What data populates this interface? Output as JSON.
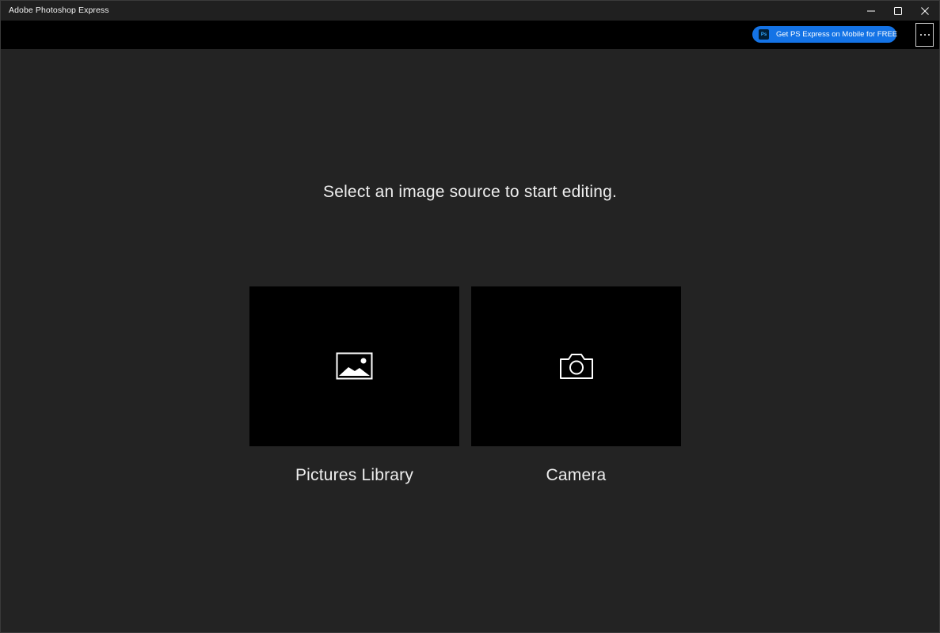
{
  "window": {
    "title": "Adobe Photoshop Express",
    "controls": {
      "minimize_icon": "minimize-icon",
      "maximize_icon": "maximize-icon",
      "close_icon": "close-icon"
    }
  },
  "toolbar": {
    "promo_label": "Get PS Express on Mobile for FREE",
    "promo_icon_text": "Ps",
    "more_icon": "more-options-icon"
  },
  "main": {
    "prompt": "Select an image source to start editing.",
    "sources": [
      {
        "label": "Pictures Library",
        "icon": "image-icon"
      },
      {
        "label": "Camera",
        "icon": "camera-icon"
      }
    ]
  },
  "colors": {
    "background": "#232323",
    "toolbar": "#000000",
    "tile": "#000000",
    "accent": "#1473e6",
    "text": "#eeeeee"
  }
}
